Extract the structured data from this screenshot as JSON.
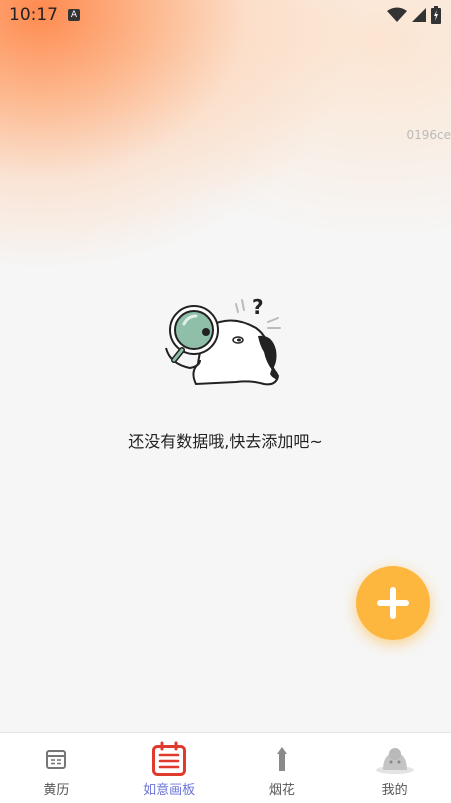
{
  "status_bar": {
    "time": "10:17",
    "notification_icon": "A",
    "icons": [
      "wifi-icon",
      "signal-icon",
      "battery-icon"
    ]
  },
  "version_tag": "0196ce",
  "empty_state": {
    "illustration": "magnifier-character-icon",
    "message": "还没有数据哦,快去添加吧~"
  },
  "fab": {
    "icon": "plus-icon",
    "color": "#fdb73f"
  },
  "bottom_nav": {
    "active_index": 1,
    "active_color": "#6a74d9",
    "items": [
      {
        "label": "黄历",
        "icon": "calendar-icon"
      },
      {
        "label": "如意画板",
        "icon": "board-icon"
      },
      {
        "label": "烟花",
        "icon": "firework-icon"
      },
      {
        "label": "我的",
        "icon": "profile-icon"
      }
    ]
  }
}
